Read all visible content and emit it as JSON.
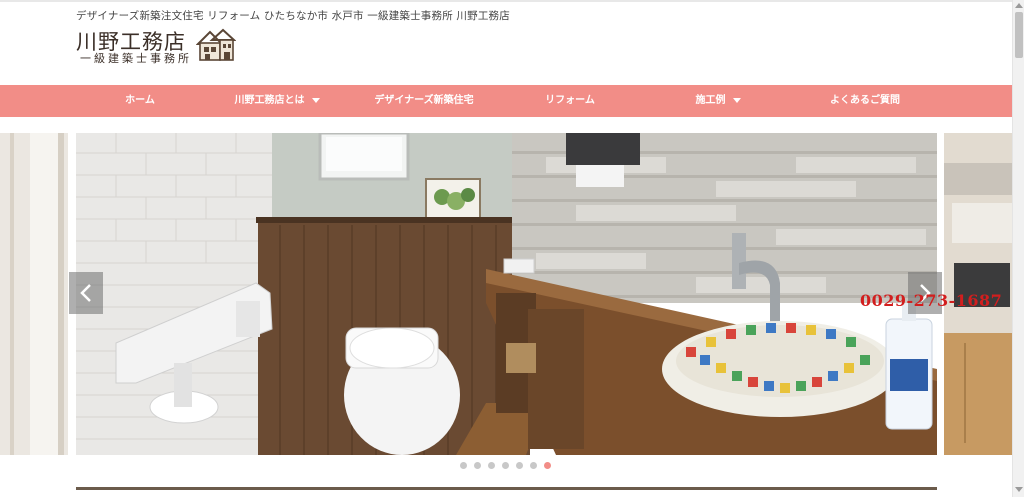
{
  "header": {
    "tagline": "デザイナーズ新築注文住宅 リフォーム ひたちなか市 水戸市 一級建築士事務所 川野工務店",
    "logo_main": "川野工務店",
    "logo_sub": "一級建築士事務所"
  },
  "nav": {
    "items": [
      {
        "label": "ホーム",
        "has_dropdown": false
      },
      {
        "label": "川野工務店とは",
        "has_dropdown": true
      },
      {
        "label": "デザイナーズ新築住宅",
        "has_dropdown": false
      },
      {
        "label": "リフォーム",
        "has_dropdown": false
      },
      {
        "label": "施工例",
        "has_dropdown": true
      },
      {
        "label": "よくあるご質問",
        "has_dropdown": false
      }
    ],
    "background_color": "#f28d87"
  },
  "slider": {
    "slide_count": 7,
    "active_index": 6,
    "phone_overlay": "0029-273-1687",
    "icons": [
      "chevron-left-icon",
      "chevron-right-icon"
    ]
  }
}
